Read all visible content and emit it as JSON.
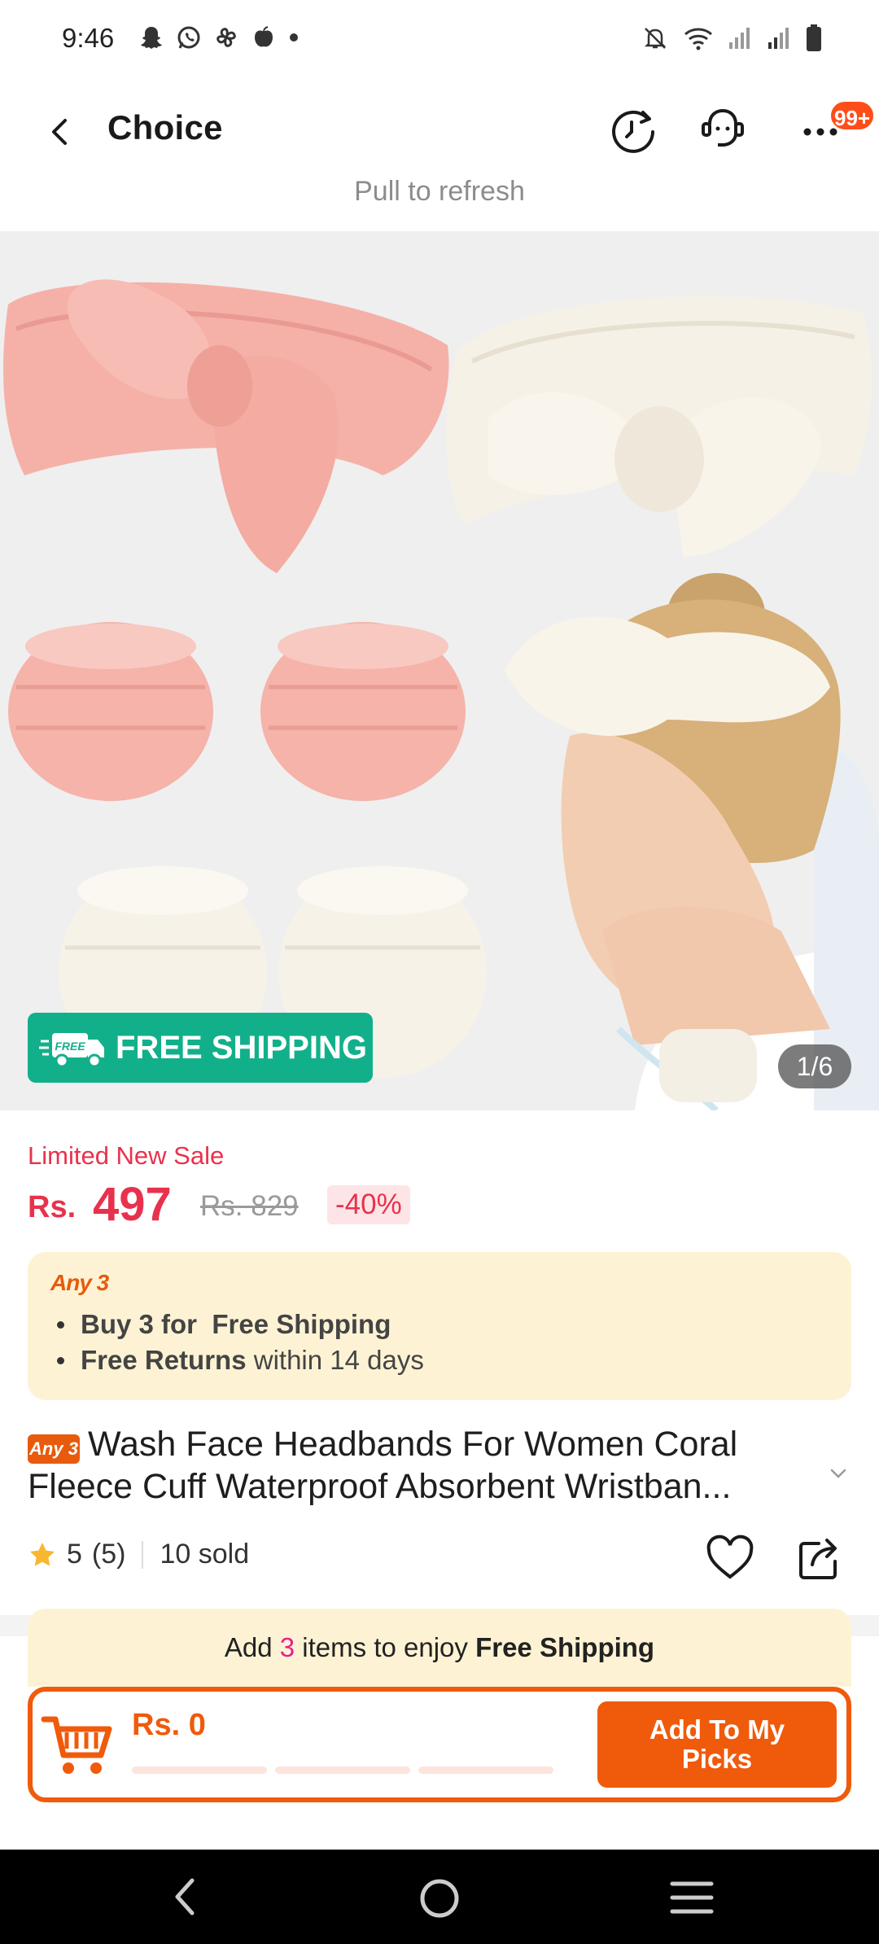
{
  "status_bar": {
    "time": "9:46",
    "left_icons": [
      "snapchat-icon",
      "whatsapp-icon",
      "pinwheel-icon",
      "apple-icon",
      "dot-icon"
    ],
    "right_icons": [
      "bell-off-icon",
      "wifi-icon",
      "signal-icon",
      "signal-icon",
      "battery-icon"
    ]
  },
  "header": {
    "title": "Choice",
    "badge": "99+",
    "pull_text": "Pull to refresh"
  },
  "hero": {
    "free_shipping_label": "FREE SHIPPING",
    "free_tag": "FREE",
    "pager": "1/6"
  },
  "price": {
    "limited_label": "Limited New Sale",
    "currency": "Rs.",
    "value": "497",
    "original": "Rs. 829",
    "discount": "-40%"
  },
  "promo": {
    "title": "Any 3",
    "line1_bold": "Buy 3 for  Free Shipping",
    "line2_bold": "Free Returns",
    "line2_rest": " within 14 days"
  },
  "product": {
    "tag": "Any 3",
    "title": "Wash Face Headbands For Women Coral Fleece Cuff Waterproof  Absorbent Wristban...",
    "rating": "5",
    "reviews": "(5)",
    "sold": "10 sold"
  },
  "cart": {
    "banner_pre": "Add ",
    "banner_count": "3",
    "banner_mid": " items to enjoy ",
    "banner_bold": "Free Shipping",
    "amount": "Rs. 0",
    "button_label": "Add To My Picks"
  },
  "colors": {
    "accent": "#f05a0b",
    "price_red": "#e8324d",
    "free_ship_green": "#12b08a"
  }
}
